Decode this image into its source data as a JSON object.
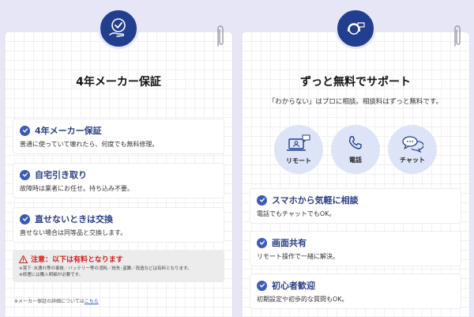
{
  "warranty": {
    "title": "4年メーカー保証",
    "items": [
      {
        "title": "4年メーカー保証",
        "desc": "普通に使っていて壊れたら、何度でも無料修理。"
      },
      {
        "title": "自宅引き取り",
        "desc": "故障時は業者にお任せ。持ち込み不要。"
      },
      {
        "title": "直せないときは交換",
        "desc": "直せない場合は同等品と交換します。"
      }
    ],
    "caution_title": "注意：以下は有料となります",
    "caution_note_1": "※落下･水濡れ等の事故／バッテリー等の消耗／紛失･盗難／改造などは有料となります。",
    "caution_note_2": "※修理には購入明細が必要です。",
    "footnote_text": "※メーカー保証の詳細については",
    "footnote_link": "こちら"
  },
  "support": {
    "title": "ずっと無料でサポート",
    "subtitle": "「わからない」はプロに相談。相談料はずっと無料です。",
    "methods": [
      {
        "label": "リモート",
        "icon": "remote-pc-icon"
      },
      {
        "label": "電話",
        "icon": "phone-icon"
      },
      {
        "label": "チャット",
        "icon": "chat-bubbles-icon"
      }
    ],
    "items": [
      {
        "title": "スマホから気軽に相談",
        "desc": "電話でもチャットでもOK。"
      },
      {
        "title": "画面共有",
        "desc": "リモート操作で一緒に解決。"
      },
      {
        "title": "初心者歓迎",
        "desc": "初期設定や初歩的な質問もOK。"
      }
    ]
  },
  "colors": {
    "navy": "#223f8f",
    "accent": "#3b5bb5",
    "danger": "#d21f1f",
    "background": "#e6e6f7"
  }
}
